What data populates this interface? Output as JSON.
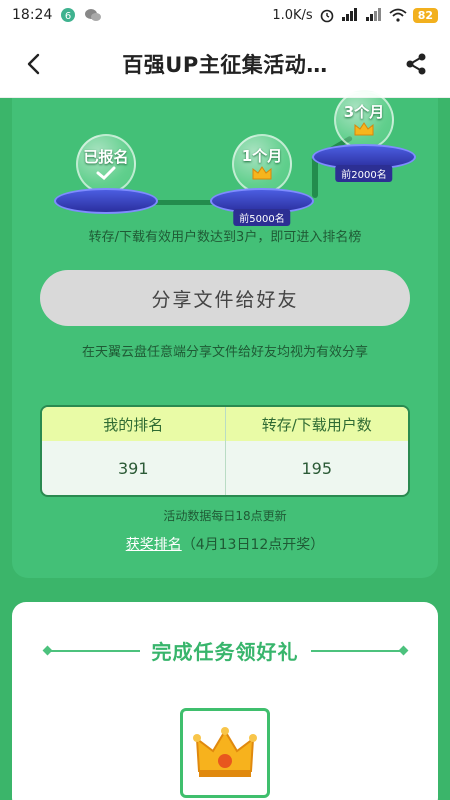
{
  "status_bar": {
    "time": "18:24",
    "speed": "1.0K/s",
    "battery": "82"
  },
  "header": {
    "title": "百强UP主征集活动…"
  },
  "progress": {
    "stages": [
      {
        "label": "已报名",
        "podium_label": ""
      },
      {
        "label": "1个月",
        "podium_label": "前5000名"
      },
      {
        "label": "3个月",
        "podium_label": "前2000名"
      }
    ],
    "requirement_text": "转存/下载有效用户数达到3户，即可进入排名榜"
  },
  "share_button": {
    "label": "分享文件给好友",
    "hint": "在天翼云盘任意端分享文件给好友均视为有效分享"
  },
  "rank_table": {
    "headers": [
      "我的排名",
      "转存/下载用户数"
    ],
    "values": [
      "391",
      "195"
    ]
  },
  "update_text": "活动数据每日18点更新",
  "award": {
    "link_label": "获奖排名",
    "note": "（4月13日12点开奖）"
  },
  "task_section": {
    "title": "完成任务领好礼"
  },
  "colors": {
    "page_bg": "#3bb56a",
    "card_green": "#43c077",
    "accent_green": "#38b56c",
    "table_header": "#e9fba6"
  }
}
